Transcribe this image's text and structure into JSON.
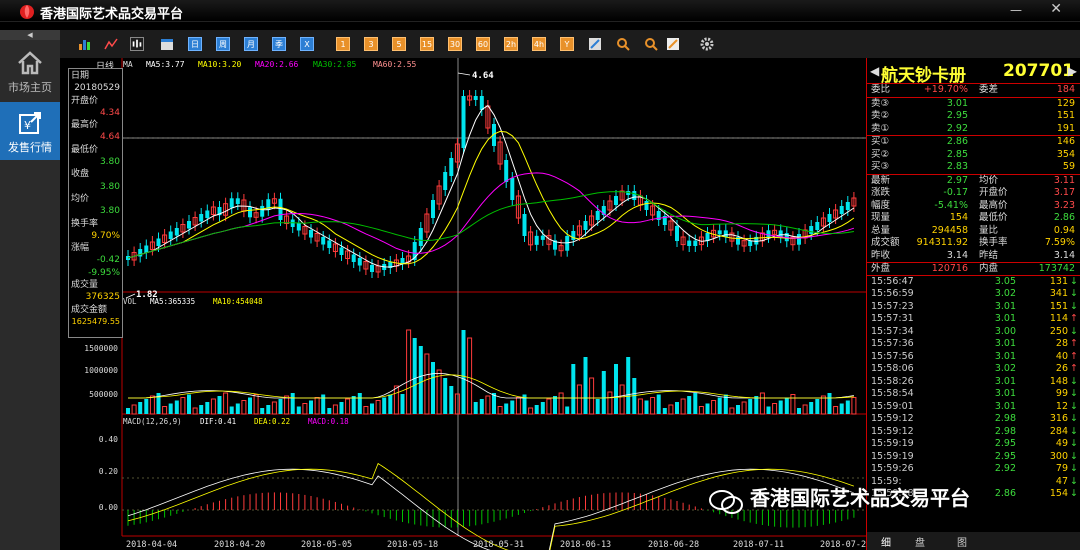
{
  "app": {
    "title": "香港国际艺术品交易平台"
  },
  "sidebar": {
    "items": [
      {
        "label": "市场主页"
      },
      {
        "label": "发售行情"
      }
    ]
  },
  "toolbar": {
    "period_buttons": [
      "日",
      "周",
      "月",
      "季",
      "X"
    ],
    "minute_buttons": [
      "1",
      "3",
      "5",
      "15",
      "30",
      "60",
      "2h",
      "4h",
      "Y"
    ]
  },
  "chart_header": {
    "period": "日线",
    "ma_label": "MA",
    "ma5": "MA5:3.77",
    "ma10": "MA10:3.20",
    "ma20": "MA20:2.66",
    "ma30": "MA30:2.85",
    "ma60": "MA60:2.55",
    "high_marker": "4.64",
    "low_marker": "1.82"
  },
  "volume_header": {
    "label": "VOL",
    "ma5": "MA5:365335",
    "ma10": "MA10:454048"
  },
  "macd_header": {
    "label": "MACD(12,26,9)",
    "dif": "DIF:0.41",
    "dea": "DEA:0.22",
    "macd": "MACD:0.18"
  },
  "price_axis": [
    "4.64"
  ],
  "volume_axis": [
    "1500000",
    "1000000",
    "500000"
  ],
  "macd_axis": [
    "0.40",
    "0.20",
    "0.00"
  ],
  "date_axis": [
    "2018-04-04",
    "2018-04-20",
    "2018-05-05",
    "2018-05-18",
    "2018-05-31",
    "2018-06-13",
    "2018-06-28",
    "2018-07-11",
    "2018-07-28"
  ],
  "infobox": {
    "date_label": "日期",
    "date": "20180529",
    "open_label": "开盘价",
    "open": "4.34",
    "high_label": "最高价",
    "high": "4.64",
    "low_label": "最低价",
    "low": "3.80",
    "close_label": "收盘",
    "close": "3.80",
    "avg_label": "均价",
    "avg": "3.80",
    "turnover_label": "换手率",
    "turnover": "9.70%",
    "change_label": "涨幅",
    "change": "-0.42",
    "change_pct": "-9.95%",
    "vol_label": "成交量",
    "vol": "376325",
    "amount_label": "成交金额",
    "amount": "1625479.55"
  },
  "quote": {
    "name": "航天钞卡册",
    "code": "207701",
    "ratio_label": "委比",
    "ratio": "+19.70%",
    "diff_label": "委差",
    "diff": "184",
    "asks": [
      {
        "label": "卖③",
        "price": "3.01",
        "qty": "129"
      },
      {
        "label": "卖②",
        "price": "2.95",
        "qty": "151"
      },
      {
        "label": "卖①",
        "price": "2.92",
        "qty": "191"
      }
    ],
    "bids": [
      {
        "label": "买①",
        "price": "2.86",
        "qty": "146"
      },
      {
        "label": "买②",
        "price": "2.85",
        "qty": "354"
      },
      {
        "label": "买③",
        "price": "2.83",
        "qty": "59"
      }
    ],
    "stats": [
      {
        "l1": "最新",
        "v1": "2.97",
        "l2": "均价",
        "v2": "3.11"
      },
      {
        "l1": "涨跌",
        "v1": "-0.17",
        "l2": "开盘价",
        "v2": "3.17"
      },
      {
        "l1": "幅度",
        "v1": "-5.41%",
        "l2": "最高价",
        "v2": "3.23"
      },
      {
        "l1": "现量",
        "v1": "154",
        "l2": "最低价",
        "v2": "2.86"
      },
      {
        "l1": "总量",
        "v1": "294458",
        "l2": "量比",
        "v2": "0.94"
      },
      {
        "l1": "成交额",
        "v1": "914311.92",
        "l2": "换手率",
        "v2": "7.59%"
      },
      {
        "l1": "昨收",
        "v1": "3.14",
        "l2": "昨结",
        "v2": "3.14"
      }
    ],
    "outer_label": "外盘",
    "outer": "120716",
    "inner_label": "内盘",
    "inner": "173742"
  },
  "ticks": [
    {
      "time": "15:56:47",
      "price": "3.05",
      "qty": "131",
      "dir": "down"
    },
    {
      "time": "15:56:59",
      "price": "3.02",
      "qty": "341",
      "dir": "down"
    },
    {
      "time": "15:57:23",
      "price": "3.01",
      "qty": "151",
      "dir": "down"
    },
    {
      "time": "15:57:31",
      "price": "3.01",
      "qty": "114",
      "dir": "up"
    },
    {
      "time": "15:57:34",
      "price": "3.00",
      "qty": "250",
      "dir": "down"
    },
    {
      "time": "15:57:36",
      "price": "3.01",
      "qty": "28",
      "dir": "up"
    },
    {
      "time": "15:57:56",
      "price": "3.01",
      "qty": "40",
      "dir": "up"
    },
    {
      "time": "15:58:06",
      "price": "3.02",
      "qty": "26",
      "dir": "up"
    },
    {
      "time": "15:58:26",
      "price": "3.01",
      "qty": "148",
      "dir": "down"
    },
    {
      "time": "15:58:54",
      "price": "3.01",
      "qty": "99",
      "dir": "down"
    },
    {
      "time": "15:59:01",
      "price": "3.01",
      "qty": "12",
      "dir": "down"
    },
    {
      "time": "15:59:12",
      "price": "2.98",
      "qty": "316",
      "dir": "down"
    },
    {
      "time": "15:59:12",
      "price": "2.98",
      "qty": "284",
      "dir": "down"
    },
    {
      "time": "15:59:19",
      "price": "2.95",
      "qty": "49",
      "dir": "down"
    },
    {
      "time": "15:59:19",
      "price": "2.95",
      "qty": "300",
      "dir": "down"
    },
    {
      "time": "15:59:26",
      "price": "2.92",
      "qty": "79",
      "dir": "down"
    },
    {
      "time": "15:59:",
      "price": "",
      "qty": "47",
      "dir": "down"
    },
    {
      "time": "15:59:48",
      "price": "2.86",
      "qty": "154",
      "dir": "down"
    }
  ],
  "bottom_tabs": [
    "细",
    "盘",
    "图"
  ],
  "watermark": "香港国际艺术品交易平台",
  "colors": {
    "up": "#ff3b3b",
    "down": "#00e5ee",
    "ma5": "#ffffff",
    "ma10": "#ffff00",
    "ma20": "#ff00ff",
    "ma30": "#00c000",
    "ma60": "#ff9090"
  }
}
